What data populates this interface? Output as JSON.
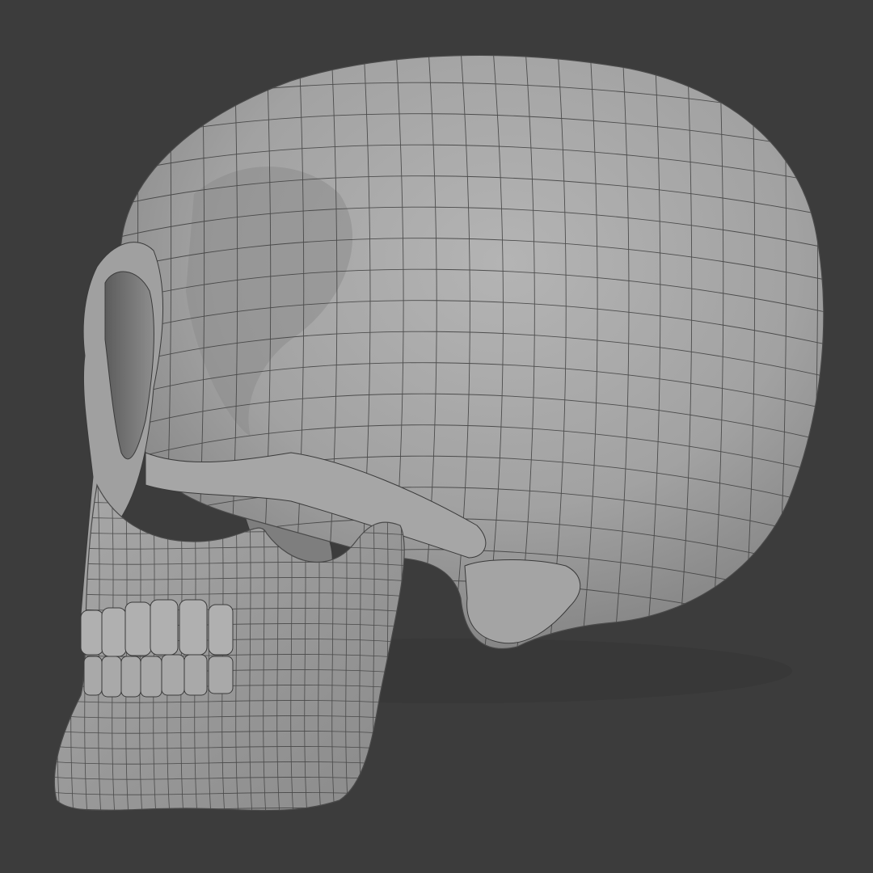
{
  "viewport": {
    "background_color": "#3c3c3c",
    "model_color": "#9c9c9c",
    "highlight_color": "#b3b3b3",
    "shadow_color": "#6e6e6e",
    "wire_color": "#3a3a3a"
  },
  "model": {
    "subject": "skull",
    "view": "side",
    "shading": "solid",
    "wireframe_overlay": true
  }
}
